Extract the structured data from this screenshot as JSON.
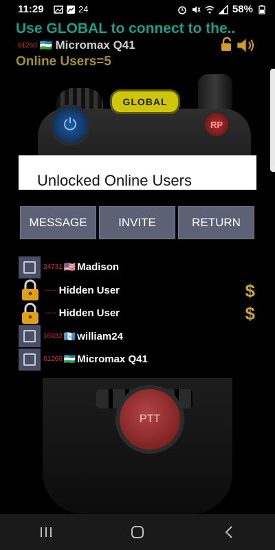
{
  "status_bar": {
    "time": "11:29",
    "notification_count": "24",
    "battery": "58%"
  },
  "header": {
    "title": "Use GLOBAL to connect to the..",
    "device_id": "61260",
    "device_flag": "🇺🇿",
    "device_name": "Micromax Q41",
    "online_users": "Online Users=5"
  },
  "device_art": {
    "global_label": "GLOBAL",
    "rp_label": "RP",
    "ptt_label": "PTT"
  },
  "dialog": {
    "title": "Unlocked Online Users",
    "buttons": {
      "message": "MESSAGE",
      "invite": "INVITE",
      "return": "RETURN"
    },
    "users": [
      {
        "id": "24731",
        "flag": "🇺🇸",
        "name": "Madison",
        "locked": false
      },
      {
        "id": "-----",
        "flag": "",
        "name": "Hidden User",
        "locked": true
      },
      {
        "id": "-----",
        "flag": "",
        "name": "Hidden User",
        "locked": true
      },
      {
        "id": "16932",
        "flag": "🇬🇹",
        "name": "william24",
        "locked": false
      },
      {
        "id": "61260",
        "flag": "🇺🇿",
        "name": "Micromax Q41",
        "locked": false
      }
    ],
    "dollar_symbol": "$"
  },
  "colors": {
    "title_teal": "#1e9c8c",
    "online_gold": "#a28f38",
    "button_bg": "#5d6176",
    "id_red": "#d62f2f"
  }
}
